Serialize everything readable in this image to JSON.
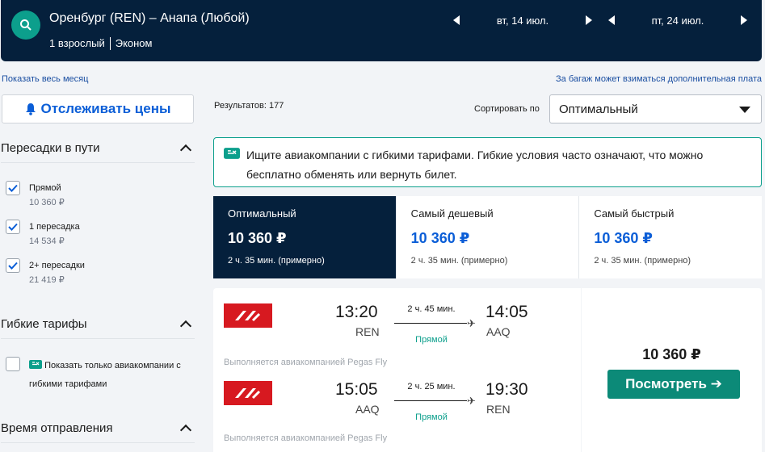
{
  "header": {
    "route": "Оренбург (REN) – Анапа (Любой)",
    "passengers": "1 взрослый",
    "cabin": "Эконом",
    "depart_date": "вт, 14 июл.",
    "return_date": "пт, 24 июл."
  },
  "links": {
    "show_month": "Показать весь месяц",
    "baggage_note": "За багаж может взиматься дополнительная плата"
  },
  "sidebar": {
    "track_prices": "Отслеживать цены",
    "stops_title": "Пересадки в пути",
    "stops": [
      {
        "label": "Прямой",
        "price": "10 360 ₽",
        "checked": true
      },
      {
        "label": "1 пересадка",
        "price": "14 534 ₽",
        "checked": true
      },
      {
        "label": "2+ пересадки",
        "price": "21 419 ₽",
        "checked": true
      }
    ],
    "flex_title": "Гибкие тарифы",
    "flex_option": "Показать только авиакомпании с гибкими тарифами",
    "departure_title": "Время отправления"
  },
  "results": {
    "count": "Результатов: 177",
    "sort_label": "Сортировать по",
    "sort_value": "Оптимальный",
    "info": "Ищите авиакомпании с гибкими тарифами. Гибкие условия часто означают, что можно бесплатно обменять или вернуть билет.",
    "tabs": [
      {
        "title": "Оптимальный",
        "price": "10 360 ₽",
        "duration": "2 ч. 35 мин. (примерно)"
      },
      {
        "title": "Самый дешевый",
        "price": "10 360 ₽",
        "duration": "2 ч. 35 мин. (примерно)"
      },
      {
        "title": "Самый быстрый",
        "price": "10 360 ₽",
        "duration": "2 ч. 35 мин. (примерно)"
      }
    ]
  },
  "flight": {
    "outbound": {
      "dep_time": "13:20",
      "dep_code": "REN",
      "arr_time": "14:05",
      "arr_code": "AAQ",
      "duration": "2 ч. 45 мин.",
      "stops": "Прямой",
      "operator": "Выполняется авиакомпанией Pegas Fly"
    },
    "inbound": {
      "dep_time": "15:05",
      "dep_code": "AAQ",
      "arr_time": "19:30",
      "arr_code": "REN",
      "duration": "2 ч. 25 мин.",
      "stops": "Прямой",
      "operator": "Выполняется авиакомпанией Pegas Fly"
    },
    "price": "10 360 ₽",
    "view_button": "Посмотреть ➔"
  },
  "colors": {
    "header_bg": "#05203c",
    "accent_teal": "#0c9f8c",
    "link_blue": "#0b5ed7",
    "airline_red": "#d71920"
  }
}
